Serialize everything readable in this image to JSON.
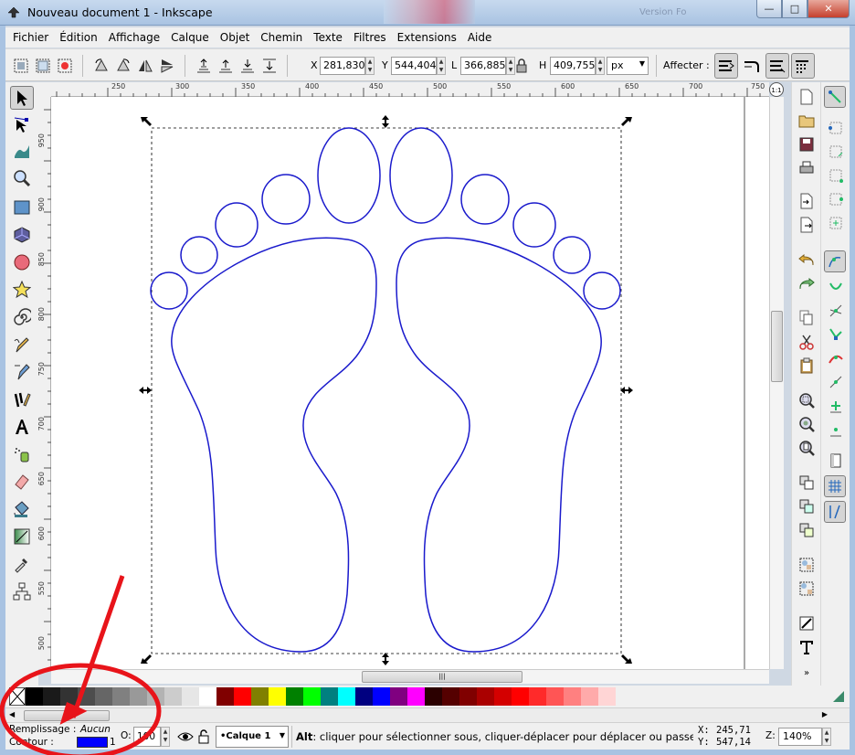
{
  "window": {
    "title": "Nouveau document 1 - Inkscape",
    "blurred_text": "Version Fo"
  },
  "menu": [
    "Fichier",
    "Édition",
    "Affichage",
    "Calque",
    "Objet",
    "Chemin",
    "Texte",
    "Filtres",
    "Extensions",
    "Aide"
  ],
  "controls": {
    "x_label": "X",
    "x_value": "281,830",
    "y_label": "Y",
    "y_value": "544,404",
    "w_label": "L",
    "w_value": "366,885",
    "h_label": "H",
    "h_value": "409,755",
    "unit": "px",
    "affect_label": "Affecter :"
  },
  "rulers": {
    "h_labels": [
      "250",
      "300",
      "350",
      "400",
      "450",
      "500",
      "550",
      "600",
      "650",
      "700",
      "750"
    ],
    "v_labels": [
      "950",
      "900",
      "850",
      "800",
      "750",
      "700",
      "650",
      "600",
      "550",
      "500"
    ]
  },
  "zoom_corner": "1:1",
  "palette": {
    "colors": [
      "#000000",
      "#1a1a1a",
      "#333333",
      "#4d4d4d",
      "#666666",
      "#808080",
      "#999999",
      "#b3b3b3",
      "#cccccc",
      "#e6e6e6",
      "#ffffff",
      "#800000",
      "#ff0000",
      "#808000",
      "#ffff00",
      "#008000",
      "#00ff00",
      "#008080",
      "#00ffff",
      "#000080",
      "#0000ff",
      "#800080",
      "#ff00ff",
      "#2b0000",
      "#550000",
      "#800000",
      "#aa0000",
      "#d40000",
      "#ff0000",
      "#ff2a2a",
      "#ff5555",
      "#ff8080",
      "#ffaaaa",
      "#ffd5d5"
    ]
  },
  "status": {
    "fill_label": "Remplissage :",
    "fill_value": "Aucun",
    "stroke_label": "Contour :",
    "stroke_width": "1",
    "stroke_color": "#0000ff",
    "opacity_label": "O:",
    "opacity_value": "100",
    "layer": "•Calque 1",
    "message_bold": "Alt",
    "message": ": cliquer pour sélectionner sous, cliquer-déplacer pour déplacer ou passer en « t...",
    "cursor_x_label": "X:",
    "cursor_x": "245,71",
    "cursor_y_label": "Y:",
    "cursor_y": "547,14",
    "zoom_label": "Z:",
    "zoom_value": "140%"
  },
  "accent_colors": {
    "path_stroke": "#1a1acc",
    "annotation": "#e8141a"
  }
}
